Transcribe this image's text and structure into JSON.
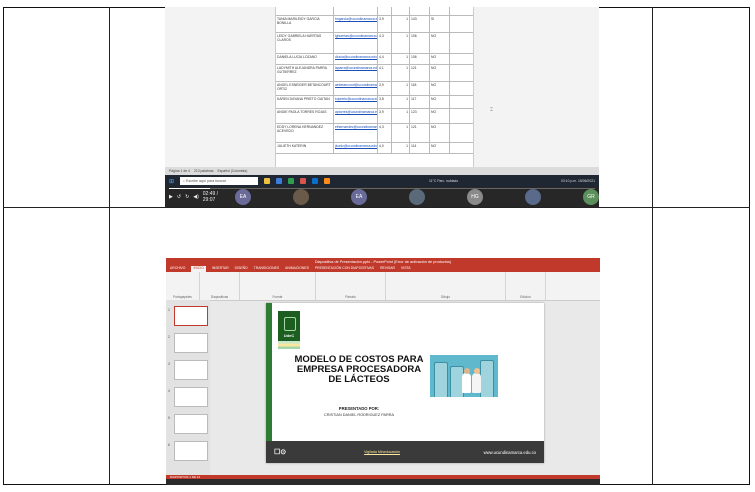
{
  "pdf_table": {
    "rows": [
      {
        "name": "",
        "mail": "",
        "num": "",
        "pos": "",
        "val": "",
        "status": ""
      },
      {
        "name": "TANIA MARILEIDY GARCIA BONILLA",
        "mail": "tmgarcia@ucundinamarca.edu.co",
        "num": "3,9",
        "pos": "1",
        "val": "143",
        "status": "SI"
      },
      {
        "name": "LEIDY GABRIELA HUERTAS CLAROS",
        "mail": "lghuertas@ucundinamarca.edu.co",
        "num": "4,3",
        "pos": "1",
        "val": "106",
        "status": "NO"
      },
      {
        "name": "DANIELA LUCIA LOZANO",
        "mail": "dlucia@ucundinamarca.edu.co",
        "num": "4,4",
        "pos": "1",
        "val": "106",
        "status": "NO"
      },
      {
        "name": "LADYMITH ALEJANDRA PARRA GUTIERREZ",
        "mail": "laparra@ucundinamarca.edu.co",
        "num": "4,1",
        "pos": "1",
        "val": "121",
        "status": "NO"
      },
      {
        "name": "ANGEL ESNEIDER BETANCOURT ORTIZ",
        "mail": "aebetancourt@ucundinamarca.edu.co",
        "num": "3,9",
        "pos": "1",
        "val": "118",
        "status": "NO"
      },
      {
        "name": "KAREN DAYANA PRIETO GAITAN",
        "mail": "kdprieto@ucundinamarca.edu.co",
        "num": "3,8",
        "pos": "1",
        "val": "117",
        "status": "NO"
      },
      {
        "name": "ANGIE PAOLA TORRES ROJAS",
        "mail": "aptorres@ucundinamarca.edu.co",
        "num": "3,9",
        "pos": "1",
        "val": "123",
        "status": "NO"
      },
      {
        "name": "EDDY LORENA HERNANDEZ ACEVEDO",
        "mail": "elhernandez@ucundinamarca.edu.co",
        "num": "4,3",
        "pos": "1",
        "val": "121",
        "status": "NO"
      },
      {
        "name": "JULIETH KATERIN",
        "mail": "jkortiz@ucundinamarca.edu.co",
        "num": "4,0",
        "pos": "1",
        "val": "114",
        "status": "NO"
      }
    ]
  },
  "pdf_status": {
    "page": "Página 1 de 4",
    "words": "213 palabras",
    "lang": "Español (Colombia)"
  },
  "taskbar": {
    "search_placeholder": "Escribe aquí para buscar",
    "weather": "11°C  Parc. nublado",
    "clock": "03:10 p.m. 15/06/2021"
  },
  "meet": {
    "time": "02:49 / 29:07",
    "progress": 0.096,
    "participants": [
      {
        "initials": "EA",
        "color": "#6b6b9a"
      },
      {
        "initials": "",
        "color": "#6a5a4a"
      },
      {
        "initials": "EA",
        "color": "#6b6b9a"
      },
      {
        "initials": "",
        "color": "#5a6a7a"
      },
      {
        "initials": "HG",
        "color": "#8a8a8a"
      },
      {
        "initials": "",
        "color": "#5a6a8a"
      },
      {
        "initials": "GR",
        "color": "#5b8f5b"
      }
    ]
  },
  "ppt": {
    "window_title": "Diapositiva de Presentación.pptx - PowerPoint (Error de activación de productos)",
    "tabs": [
      "ARCHIVO",
      "INICIO",
      "INSERTAR",
      "DISEÑO",
      "TRANSICIONES",
      "ANIMACIONES",
      "PRESENTACIÓN CON DIAPOSITIVAS",
      "REVISAR",
      "VISTA"
    ],
    "active_tab": "INICIO",
    "ribbon_groups": [
      "Portapapeles",
      "Diapositivas",
      "Fuente",
      "Párrafo",
      "Dibujo",
      "Edición"
    ],
    "thumb_numbers": [
      "1",
      "2",
      "3",
      "4",
      "5",
      "6"
    ],
    "slide": {
      "logo_text": "UdeC",
      "title": "MODELO DE COSTOS PARA EMPRESA PROCESADORA DE LÁCTEOS",
      "presented_by": "PRESENTADO POR:",
      "author": "CRISTIAN DANIEL RODRIGUEZ PARRA",
      "footer_logo": "☐⊙",
      "footer_link": "Vigilada Mineducación",
      "footer_url": "www.ucundinamarca.edu.co"
    },
    "status": "DIAPOSITIVA 1 DE 12"
  }
}
